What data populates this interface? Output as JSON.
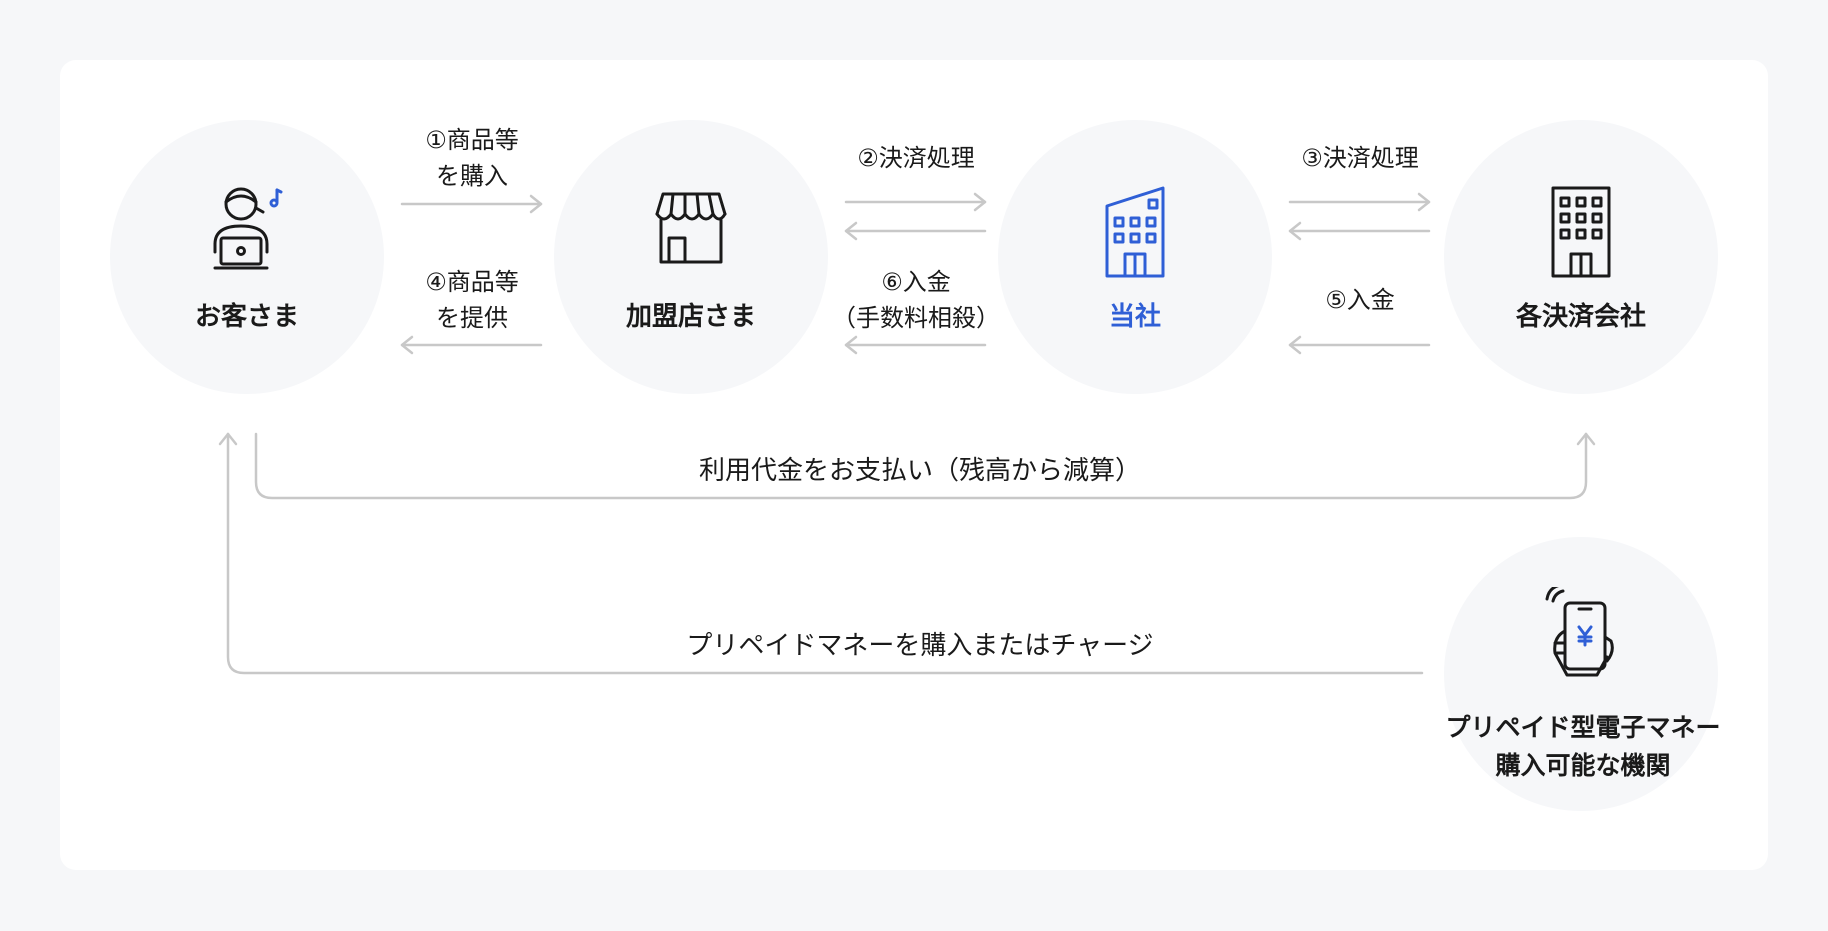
{
  "nodes": {
    "customer": "お客さま",
    "merchant": "加盟店さま",
    "company": "当社",
    "payment_companies": "各決済会社",
    "prepaid_issuer": "プリペイド型電子マネー\n購入可能な機関"
  },
  "flows": {
    "step1": "①商品等\nを購入",
    "step4": "④商品等\nを提供",
    "step2": "②決済処理",
    "step6": "⑥入金\n（手数料相殺）",
    "step3": "③決済処理",
    "step5": "⑤入金",
    "usage_payment": "利用代金をお支払い（残高から減算）",
    "prepaid_purchase": "プリペイドマネーを購入またはチャージ"
  },
  "icons": {
    "customer": "person-with-laptop-icon",
    "merchant": "storefront-icon",
    "company": "office-building-icon",
    "payment_companies": "building-icon",
    "prepaid_issuer": "hand-holding-phone-yen-icon"
  },
  "colors": {
    "accent": "#2f5fd6",
    "arrow": "#c4c4c4",
    "node_bg": "#f6f7f9",
    "page_bg": "#f6f7f9"
  }
}
